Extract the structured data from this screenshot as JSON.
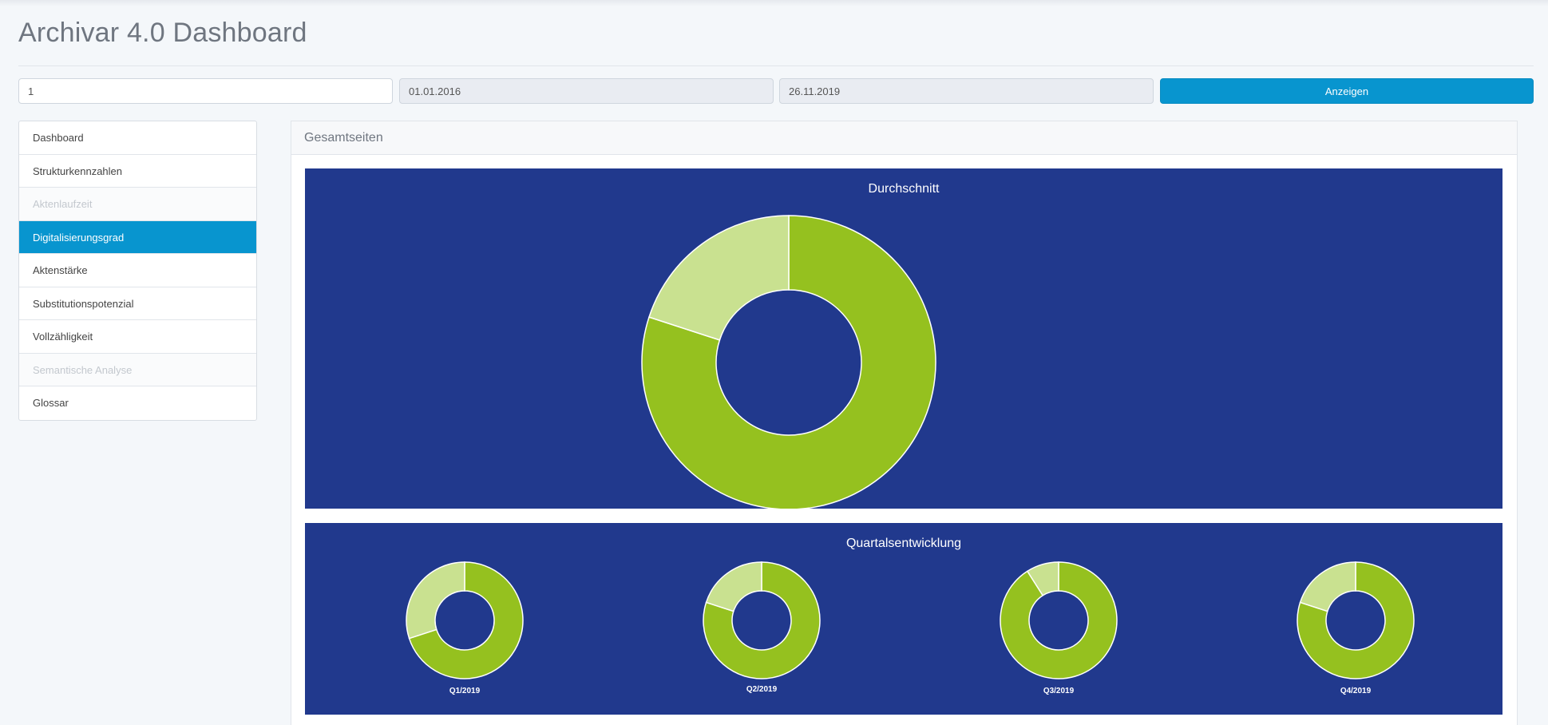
{
  "header": {
    "title": "Archivar 4.0 Dashboard"
  },
  "filters": {
    "archive_id": "1",
    "date_from": "01.01.2016",
    "date_to": "26.11.2019",
    "show_label": "Anzeigen"
  },
  "sidebar": {
    "items": [
      {
        "label": "Dashboard",
        "state": "normal"
      },
      {
        "label": "Strukturkennzahlen",
        "state": "normal"
      },
      {
        "label": "Aktenlaufzeit",
        "state": "disabled"
      },
      {
        "label": "Digitalisierungsgrad",
        "state": "active"
      },
      {
        "label": "Aktenstärke",
        "state": "normal"
      },
      {
        "label": "Substitutionspotenzial",
        "state": "normal"
      },
      {
        "label": "Vollzähligkeit",
        "state": "normal"
      },
      {
        "label": "Semantische Analyse",
        "state": "disabled"
      },
      {
        "label": "Glossar",
        "state": "normal"
      }
    ]
  },
  "panel": {
    "title": "Gesamtseiten"
  },
  "colors": {
    "chart_background": "#21398d",
    "slice_primary": "#95c11f",
    "slice_secondary": "#c9e190",
    "accent": "#0895cf"
  },
  "chart_data": [
    {
      "type": "pie",
      "variant": "donut",
      "title": "Durchschnitt",
      "slices": [
        {
          "value": 80
        },
        {
          "value": 20
        }
      ]
    },
    {
      "type": "pie",
      "variant": "donut",
      "title": "Quartalsentwicklung",
      "quarters": [
        {
          "label": "Q1/2019",
          "slices": [
            {
              "value": 70
            },
            {
              "value": 30
            }
          ]
        },
        {
          "label": "Q2/2019",
          "slices": [
            {
              "value": 80
            },
            {
              "value": 20
            }
          ]
        },
        {
          "label": "Q3/2019",
          "slices": [
            {
              "value": 91
            },
            {
              "value": 9
            }
          ]
        },
        {
          "label": "Q4/2019",
          "slices": [
            {
              "value": 80
            },
            {
              "value": 20
            }
          ]
        }
      ]
    }
  ]
}
